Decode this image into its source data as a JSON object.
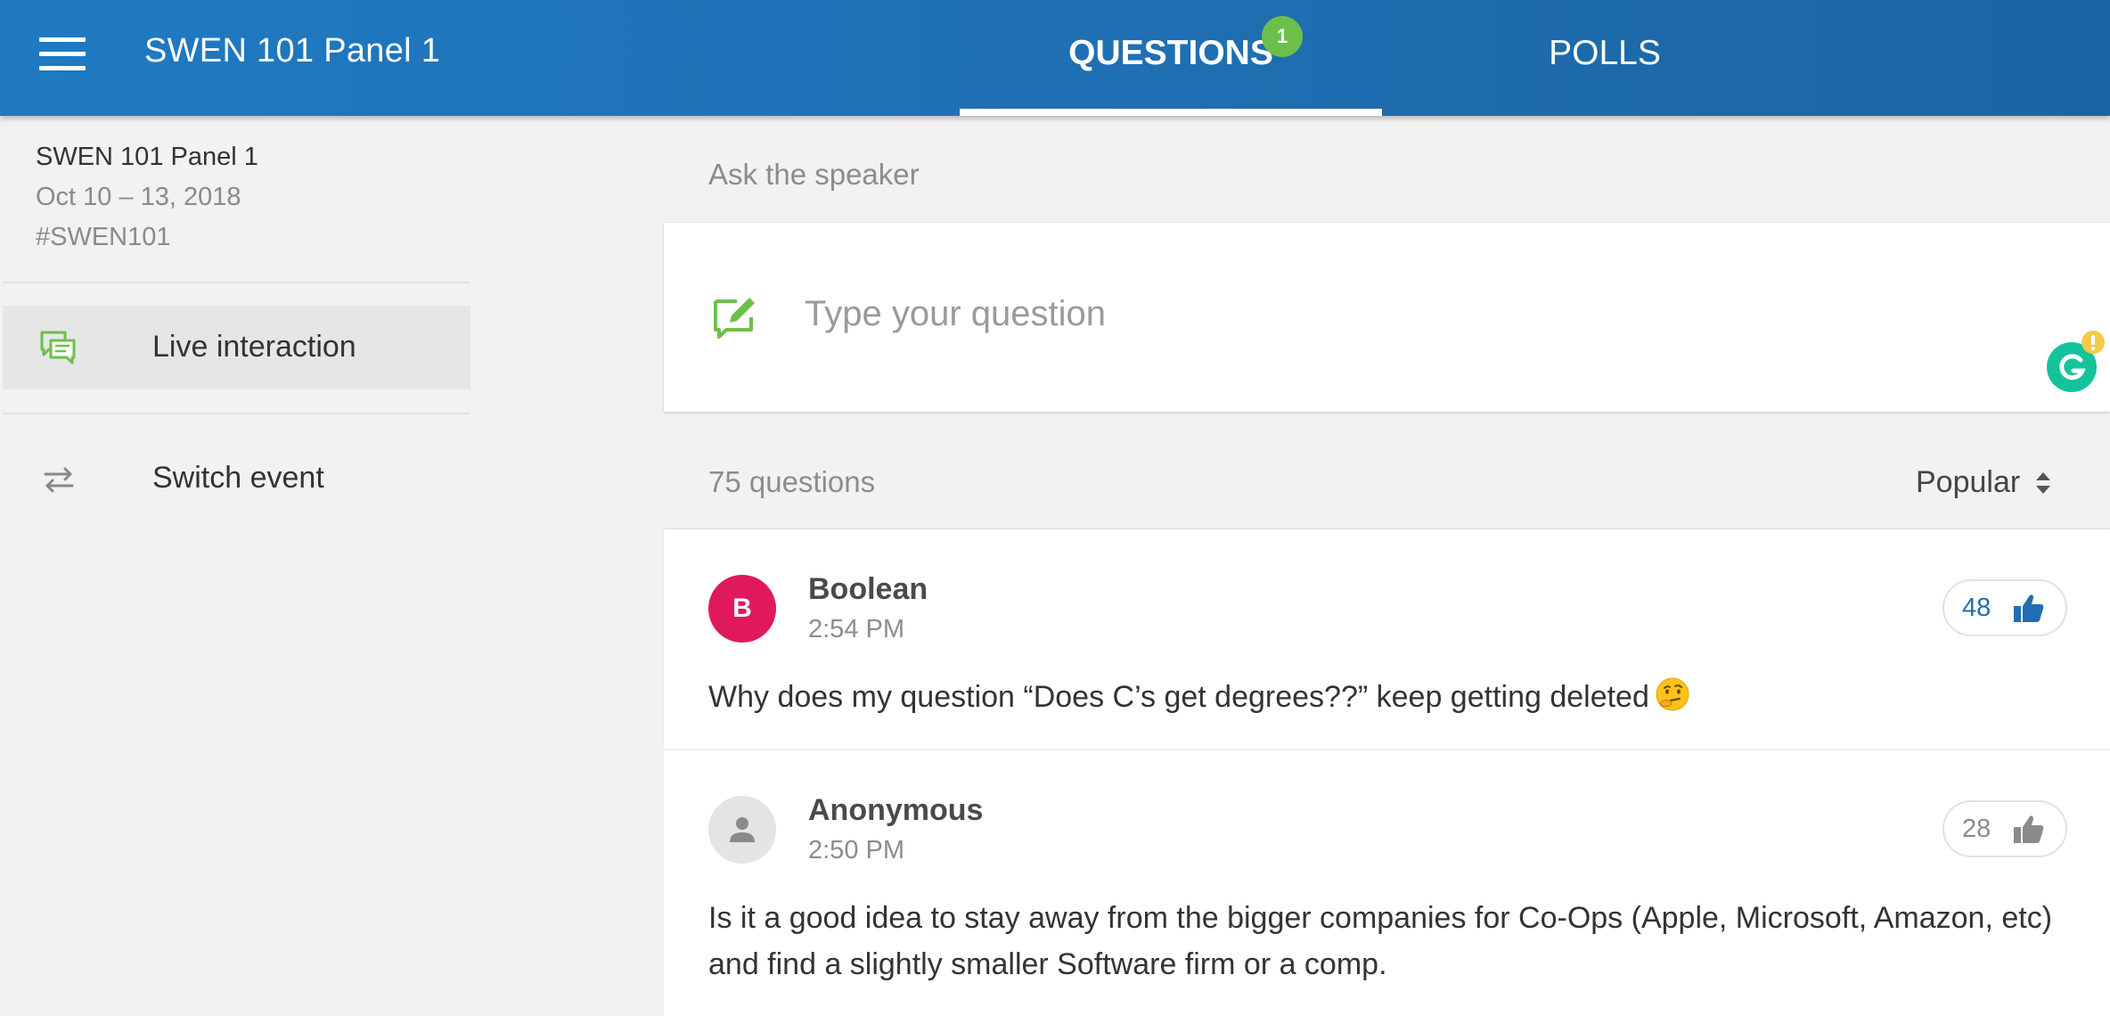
{
  "header": {
    "title": "SWEN 101 Panel 1",
    "tabs": [
      {
        "label": "QUESTIONS",
        "badge": "1",
        "active": true
      },
      {
        "label": "POLLS",
        "active": false
      }
    ]
  },
  "sidebar": {
    "event_name": "SWEN 101 Panel 1",
    "event_dates": "Oct 10 – 13, 2018",
    "event_hashtag": "#SWEN101",
    "items": [
      {
        "label": "Live interaction",
        "icon": "chat-bubbles-icon",
        "active": true
      },
      {
        "label": "Switch event",
        "icon": "swap-arrows-icon",
        "active": false
      }
    ]
  },
  "ask": {
    "label": "Ask the speaker",
    "placeholder": "Type your question"
  },
  "questions_header": {
    "count": "75 questions",
    "sort_label": "Popular"
  },
  "questions": [
    {
      "avatar_letter": "B",
      "author": "Boolean",
      "time": "2:54 PM",
      "likes": "48",
      "liked": true,
      "text": "Why does my question “Does C’s get degrees??” keep getting deleted",
      "emoji": "thinking-face"
    },
    {
      "avatar_letter": "",
      "author": "Anonymous",
      "time": "2:50 PM",
      "likes": "28",
      "liked": false,
      "text": "Is it a good idea to stay away from the bigger companies for Co-Ops (Apple, Microsoft, Amazon, etc) and find a slightly smaller Software firm or a comp."
    }
  ],
  "colors": {
    "header_blue": "#1f6fb2",
    "accent_green": "#6cc04a",
    "like_blue": "#1f6fb2",
    "avatar_pink": "#e0195f"
  }
}
